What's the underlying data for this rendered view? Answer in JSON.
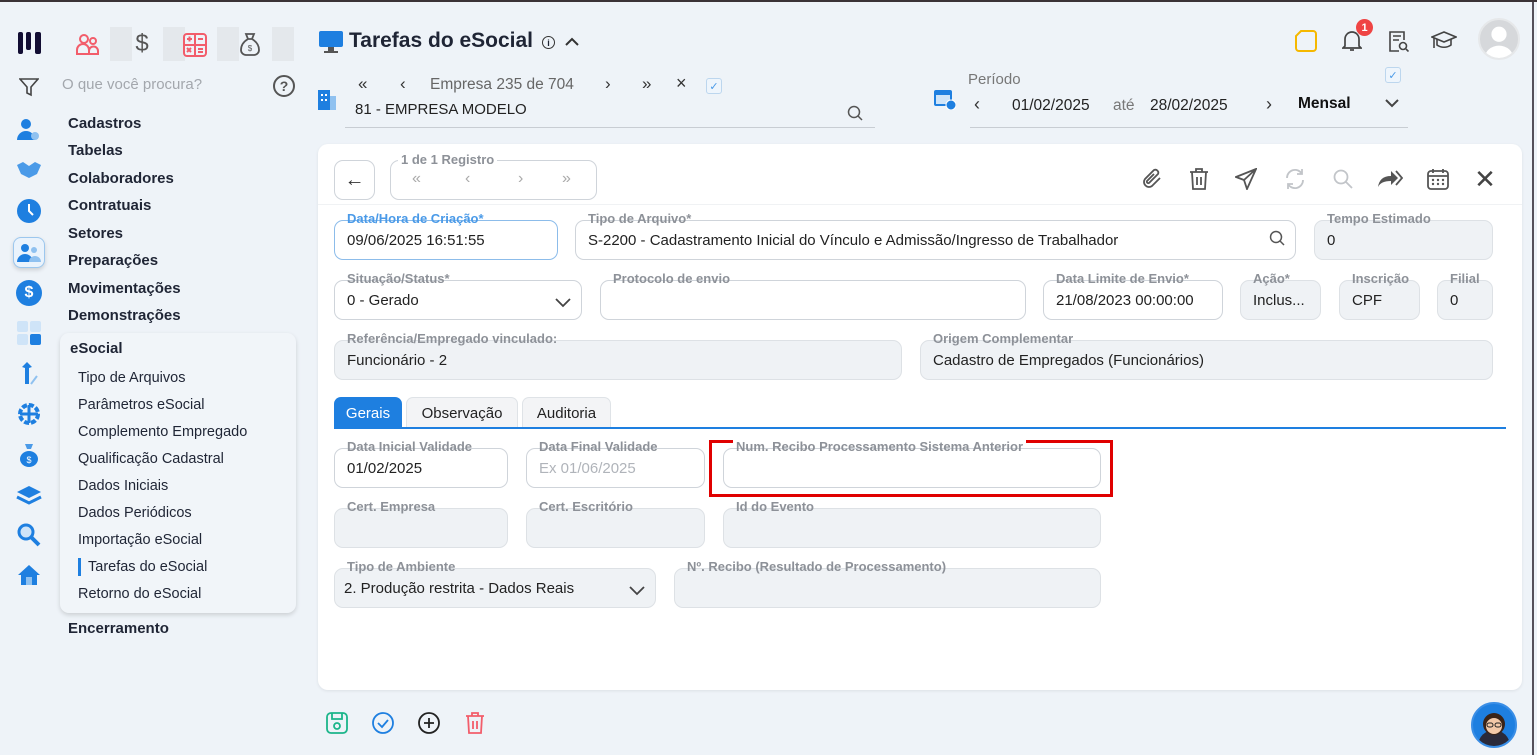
{
  "sidebar": {
    "search_placeholder": "O que você procura?",
    "menu": [
      "Cadastros",
      "Tabelas",
      "Colaboradores",
      "Contratuais",
      "Setores",
      "Preparações",
      "Movimentações",
      "Demonstrações"
    ],
    "esocial": {
      "title": "eSocial",
      "items": [
        "Tipo de Arquivos",
        "Parâmetros eSocial",
        "Complemento Empregado",
        "Qualificação Cadastral",
        "Dados Iniciais",
        "Dados Periódicos",
        "Importação eSocial",
        "Tarefas do eSocial",
        "Retorno do eSocial"
      ],
      "active": "Tarefas do eSocial"
    },
    "after": "Encerramento"
  },
  "header": {
    "title": "Tarefas do eSocial",
    "empresa_nav": "Empresa 235 de 704",
    "empresa_value": "81 - EMPRESA MODELO",
    "periodo_label": "Período",
    "date_from": "01/02/2025",
    "ate": "até",
    "date_to": "28/02/2025",
    "periodicity": "Mensal",
    "notification_count": "1",
    "colors": {
      "accent": "#1e7fe0",
      "highlight": "#e00000",
      "note": "#f5b800",
      "badge": "#ef4444"
    }
  },
  "card": {
    "pager_label": "1 de 1 Registro",
    "fields": {
      "data_hora": {
        "label": "Data/Hora de Criação*",
        "value": "09/06/2025 16:51:55"
      },
      "tipo_arquivo": {
        "label": "Tipo de Arquivo*",
        "value": "S-2200 - Cadastramento Inicial do Vínculo e Admissão/Ingresso de Trabalhador"
      },
      "tempo": {
        "label": "Tempo Estimado",
        "value": "0"
      },
      "situacao": {
        "label": "Situação/Status*",
        "value": "0 - Gerado"
      },
      "protocolo": {
        "label": "Protocolo de envio",
        "value": ""
      },
      "data_limite": {
        "label": "Data Limite de Envio*",
        "value": "21/08/2023 00:00:00"
      },
      "acao": {
        "label": "Ação*",
        "value": "Inclus..."
      },
      "inscricao": {
        "label": "Inscrição",
        "value": "CPF"
      },
      "filial": {
        "label": "Filial",
        "value": "0"
      },
      "referencia": {
        "label": "Referência/Empregado vinculado:",
        "value": "Funcionário - 2"
      },
      "origem": {
        "label": "Origem Complementar",
        "value": "Cadastro de Empregados (Funcionários)"
      }
    },
    "tabs": [
      "Gerais",
      "Observação",
      "Auditoria"
    ],
    "active_tab": "Gerais",
    "gerais": {
      "data_inicial": {
        "label": "Data Inicial Validade",
        "value": "01/02/2025"
      },
      "data_final": {
        "label": "Data Final Validade",
        "placeholder": "Ex 01/06/2025"
      },
      "num_recibo_anterior": {
        "label": "Num. Recibo Processamento Sistema Anterior",
        "value": ""
      },
      "cert_empresa": {
        "label": "Cert. Empresa",
        "value": ""
      },
      "cert_escritorio": {
        "label": "Cert. Escritório",
        "value": ""
      },
      "id_evento": {
        "label": "Id do Evento",
        "value": ""
      },
      "tipo_ambiente": {
        "label": "Tipo de Ambiente",
        "value": "2. Produção restrita - Dados Reais"
      },
      "num_recibo": {
        "label": "Nº. Recibo (Resultado de Processamento)",
        "value": ""
      }
    }
  }
}
